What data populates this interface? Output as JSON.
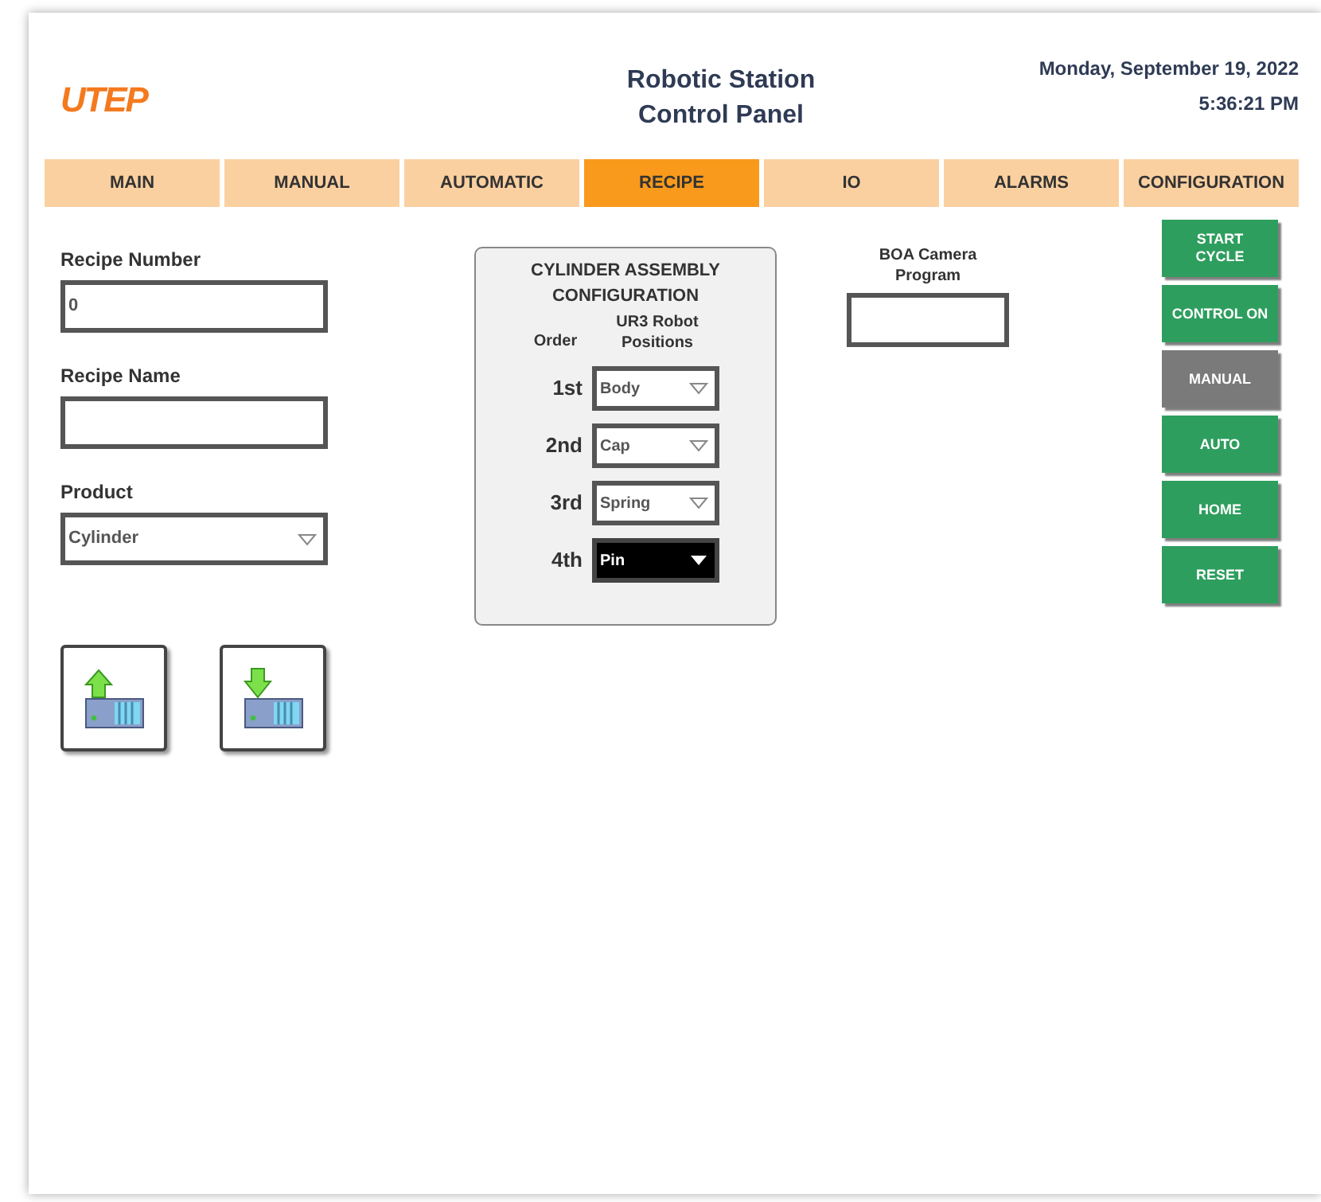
{
  "header": {
    "logo": "UTEP",
    "title_lines": [
      "Robotic Station",
      "Control Panel"
    ],
    "date": "Monday, September 19, 2022",
    "time": "5:36:21 PM"
  },
  "tabs": [
    {
      "label": "MAIN",
      "selected": false
    },
    {
      "label": "MANUAL",
      "selected": false
    },
    {
      "label": "AUTOMATIC",
      "selected": false
    },
    {
      "label": "RECIPE",
      "selected": true
    },
    {
      "label": "IO",
      "selected": false
    },
    {
      "label": "ALARMS",
      "selected": false
    },
    {
      "label": "CONFIGURATION",
      "selected": false
    }
  ],
  "recipe_number": {
    "label": "Recipe Number",
    "value": "0"
  },
  "recipe_name": {
    "label": "Recipe Name"
  },
  "product": {
    "label": "Product",
    "value": "Cylinder"
  },
  "assembly": {
    "title": "CYLINDER ASSEMBLY CONFIGURATION",
    "order_header": "Order",
    "positions_header": "UR3 Robot Positions",
    "rows": [
      {
        "order": "1st",
        "value": "Body",
        "selected": false
      },
      {
        "order": "2nd",
        "value": "Cap",
        "selected": false
      },
      {
        "order": "3rd",
        "value": "Spring",
        "selected": false
      },
      {
        "order": "4th",
        "value": "Pin",
        "selected": true
      }
    ]
  },
  "camera": {
    "label": "BOA Camera Program"
  },
  "side_buttons": [
    {
      "label": "START CYCLE",
      "enabled": true
    },
    {
      "label": "CONTROL ON",
      "enabled": true
    },
    {
      "label": "MANUAL",
      "enabled": false
    },
    {
      "label": "AUTO",
      "enabled": true
    },
    {
      "label": "HOME",
      "enabled": true
    },
    {
      "label": "RESET",
      "enabled": true
    }
  ]
}
